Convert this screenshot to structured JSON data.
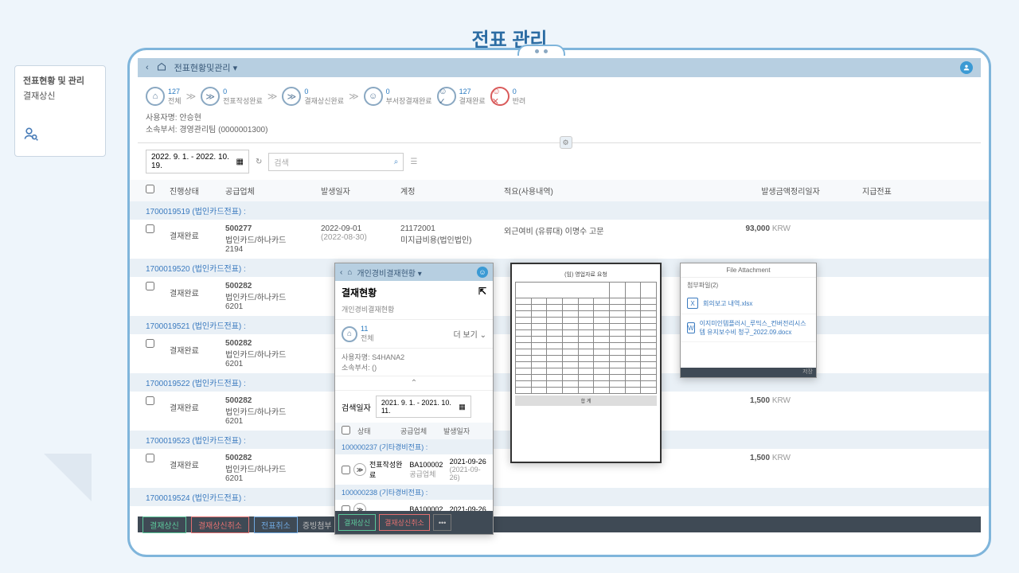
{
  "page_title": "전표 관리",
  "side": {
    "title": "전표현황 및 관리",
    "sub": "결재상신"
  },
  "toolbar": {
    "dropdown": "전표현황및관리"
  },
  "workflow": [
    {
      "count": "127",
      "label": "전체",
      "icon": "⌂"
    },
    {
      "count": "0",
      "label": "전표작성완료",
      "icon": "≫"
    },
    {
      "count": "0",
      "label": "결재상신완료",
      "icon": "≫"
    },
    {
      "count": "0",
      "label": "부서장결재완료",
      "icon": "☺"
    },
    {
      "count": "127",
      "label": "결재완료",
      "icon": "☺✓"
    },
    {
      "count": "0",
      "label": "반려",
      "icon": "☺✕",
      "red": true
    }
  ],
  "user": {
    "name": "사용자명: 안승현",
    "dept": "소속부서: 경영관리팀 (0000001300)"
  },
  "filters": {
    "date_range": "2022. 9. 1. - 2022. 10. 19.",
    "search_placeholder": "검색"
  },
  "columns": {
    "status": "진행상태",
    "vendor": "공급업체",
    "date": "발생일자",
    "account": "계정",
    "memo": "적요(사용내역)",
    "amount": "발생금액",
    "cleardate": "정리일자",
    "payslip": "지급전표"
  },
  "groups": [
    {
      "id": "1700019519 (법인카드전표) :",
      "row": {
        "status": "결재완료",
        "vendor_code": "500277",
        "vendor_name": "법인카드/하나카드",
        "vendor_sub": "2194",
        "date": "2022-09-01",
        "date_sub": "(2022-08-30)",
        "account": "21172001",
        "account_name": "미지급비용(법인법인)",
        "memo": "외근여비 (유류대) 이명수 고문",
        "amount": "93,000",
        "currency": "KRW"
      }
    },
    {
      "id": "1700019520 (법인카드전표) :",
      "row": {
        "status": "결재완료",
        "vendor_code": "500282",
        "vendor_name": "법인카드/하나카드",
        "vendor_sub": "6201"
      }
    },
    {
      "id": "1700019521 (법인카드전표) :",
      "row": {
        "status": "결재완료",
        "vendor_code": "500282",
        "vendor_name": "법인카드/하나카드",
        "vendor_sub": "6201"
      }
    },
    {
      "id": "1700019522 (법인카드전표) :",
      "row": {
        "status": "결재완료",
        "vendor_code": "500282",
        "vendor_name": "법인카드/하나카드",
        "vendor_sub": "6201",
        "amount": "1,500",
        "currency": "KRW"
      }
    },
    {
      "id": "1700019523 (법인카드전표) :",
      "row": {
        "status": "결재완료",
        "vendor_code": "500282",
        "vendor_name": "법인카드/하나카드",
        "vendor_sub": "6201",
        "amount": "1,500",
        "currency": "KRW"
      }
    },
    {
      "id": "1700019524 (법인카드전표) :"
    }
  ],
  "bottom": {
    "approve": "결재상신",
    "cancel": "결재상신취소",
    "voucher": "전표취소",
    "attach": "증빙첨부"
  },
  "popup_left": {
    "bar": "개인경비결재현황",
    "title": "결재현황",
    "sub": "개인경비결재현황",
    "wf_count": "11",
    "wf_label": "전체",
    "more": "더 보기",
    "user": "사용자명: S4HANA2",
    "dept": "소속부서: ()",
    "filter_label": "검색일자",
    "filter_date": "2021. 9. 1. - 2021. 10. 11.",
    "th_status": "상태",
    "th_vendor": "공급업체",
    "th_date": "발생일자",
    "g1": "100000237 (기타경비전표) :",
    "r1_status": "전표작성완료",
    "r1_vendor": "BA100002",
    "r1_vendor2": "공급업체",
    "r1_date": "2021-09-26",
    "r1_date2": "(2021-09-26)",
    "g2": "100000238 (기타경비전표) :",
    "r2_vendor": "BA100002",
    "r2_date": "2021-09-26",
    "btn_approve": "결재상신",
    "btn_cancel": "결재상신취소",
    "btn_more": "•••"
  },
  "popup_mid": {
    "header": "(임) 영업자료 요청",
    "footer": "합 계"
  },
  "popup_right": {
    "title": "File Attachment",
    "label": "첨부파일(2)",
    "file1": "회의보고 내역.xlsx",
    "file2": "이지미인템플러시_루믹스_컨버전리시스템 유지보수비 청구_2022.09.docx",
    "foot": "저장"
  }
}
